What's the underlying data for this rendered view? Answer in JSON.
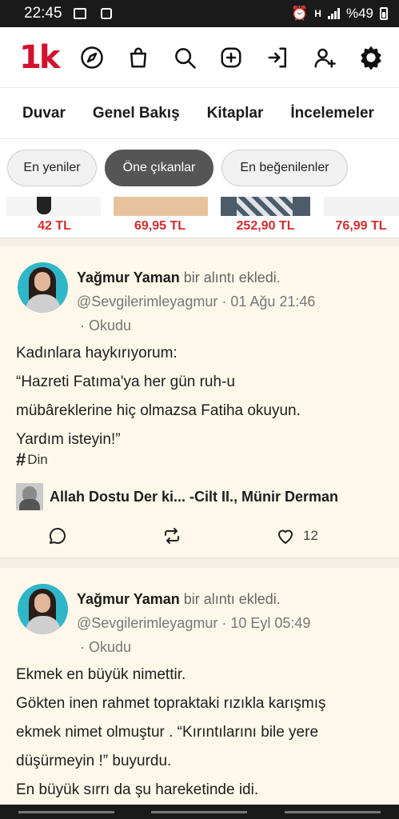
{
  "status_bar": {
    "time": "22:45",
    "network": "H",
    "battery": "%49"
  },
  "app": {
    "logo": "1k",
    "icons": [
      "compass-icon",
      "bag-icon",
      "search-icon",
      "add-icon",
      "login-icon",
      "add-user-icon",
      "settings-icon"
    ]
  },
  "tabs": [
    {
      "label": "Duvar"
    },
    {
      "label": "Genel Bakış"
    },
    {
      "label": "Kitaplar"
    },
    {
      "label": "İncelemeler"
    }
  ],
  "filters": [
    {
      "label": "En yeniler",
      "active": false
    },
    {
      "label": "Öne çıkanlar",
      "active": true
    },
    {
      "label": "En beğenilenler",
      "active": false
    }
  ],
  "ads": [
    {
      "price": "42 TL"
    },
    {
      "price": "69,95 TL"
    },
    {
      "price": "252,90 TL"
    },
    {
      "price": "76,99 TL"
    }
  ],
  "posts": [
    {
      "user": "Yağmur Yaman",
      "action": "bir alıntı ekledi.",
      "handle": "@Sevgilerimleyagmur",
      "date": "01 Ağu 21:46",
      "status": "· Okudu",
      "lines": [
        "Kadınlara haykırıyorum:",
        "“Hazreti Fatıma'ya her gün ruh-u",
        "mübâreklerine hiç olmazsa Fatiha okuyun.",
        "Yardım isteyin!”"
      ],
      "tag": "Din",
      "book": "Allah Dostu Der ki... -Cilt II., Münir Derman",
      "likes": "12"
    },
    {
      "user": "Yağmur Yaman",
      "action": "bir alıntı ekledi.",
      "handle": "@Sevgilerimleyagmur",
      "date": "10 Eyl 05:49",
      "status": "· Okudu",
      "lines": [
        "Ekmek en büyük nimettir.",
        "Gökten inen rahmet topraktaki rızıkla karışmış",
        "ekmek nimet olmuştur . “Kırıntılarını bile yere",
        "düşürmeyin !” buyurdu.",
        "En büyük sırrı da şu hareketinde idi."
      ]
    }
  ],
  "colors": {
    "logo": "#d2122e",
    "price": "#d62b2b",
    "feed_bg": "#fdf8ea",
    "pill_active": "#555555"
  }
}
